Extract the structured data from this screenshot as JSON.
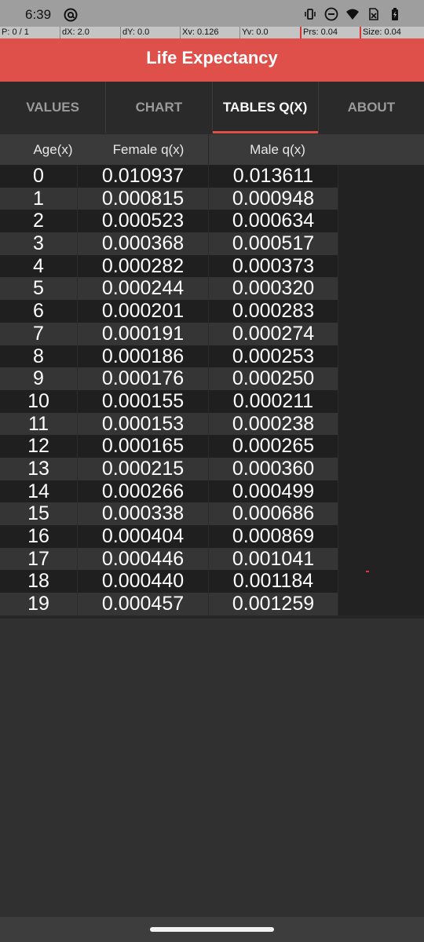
{
  "status_bar": {
    "time": "6:39",
    "icons": [
      "at-sign-icon",
      "vibrate-icon",
      "do-not-disturb-icon",
      "wifi-icon",
      "no-sim-icon",
      "battery-charging-icon"
    ]
  },
  "pointer_overlay": {
    "p": "P: 0 / 1",
    "dx": "dX: 2.0",
    "dy": "dY: 0.0",
    "xv": "Xv: 0.126",
    "yv": "Yv: 0.0",
    "prs": "Prs: 0.04",
    "size": "Size: 0.04"
  },
  "app": {
    "title": "Life Expectancy",
    "accent_color": "#e0504b"
  },
  "tabs": [
    {
      "label": "VALUES",
      "active": false
    },
    {
      "label": "CHART",
      "active": false
    },
    {
      "label": "TABLES Q(X)",
      "active": true
    },
    {
      "label": "ABOUT",
      "active": false
    }
  ],
  "table": {
    "headers": [
      "Age(x)",
      "Female q(x)",
      "Male q(x)"
    ],
    "rows": [
      [
        "0",
        "0.010937",
        "0.013611"
      ],
      [
        "1",
        "0.000815",
        "0.000948"
      ],
      [
        "2",
        "0.000523",
        "0.000634"
      ],
      [
        "3",
        "0.000368",
        "0.000517"
      ],
      [
        "4",
        "0.000282",
        "0.000373"
      ],
      [
        "5",
        "0.000244",
        "0.000320"
      ],
      [
        "6",
        "0.000201",
        "0.000283"
      ],
      [
        "7",
        "0.000191",
        "0.000274"
      ],
      [
        "8",
        "0.000186",
        "0.000253"
      ],
      [
        "9",
        "0.000176",
        "0.000250"
      ],
      [
        "10",
        "0.000155",
        "0.000211"
      ],
      [
        "11",
        "0.000153",
        "0.000238"
      ],
      [
        "12",
        "0.000165",
        "0.000265"
      ],
      [
        "13",
        "0.000215",
        "0.000360"
      ],
      [
        "14",
        "0.000266",
        "0.000499"
      ],
      [
        "15",
        "0.000338",
        "0.000686"
      ],
      [
        "16",
        "0.000404",
        "0.000869"
      ],
      [
        "17",
        "0.000446",
        "0.001041"
      ],
      [
        "18",
        "0.000440",
        "0.001184"
      ],
      [
        "19",
        "0.000457",
        "0.001259"
      ]
    ]
  }
}
